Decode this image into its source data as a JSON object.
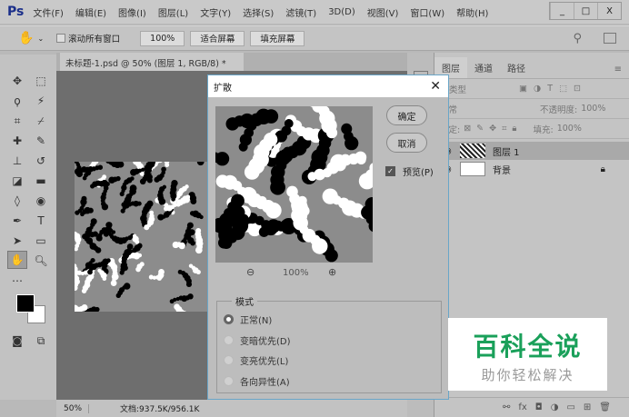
{
  "app": {
    "logo": "Ps",
    "menus": [
      "文件(F)",
      "编辑(E)",
      "图像(I)",
      "图层(L)",
      "文字(Y)",
      "选择(S)",
      "滤镜(T)",
      "3D(D)",
      "视图(V)",
      "窗口(W)",
      "帮助(H)"
    ],
    "window_buttons": [
      "_",
      "□",
      "X"
    ]
  },
  "options": {
    "scroll_all": "滚动所有窗口",
    "zoom_100": "100%",
    "fit_screen": "适合屏幕",
    "fill_screen": "填充屏幕"
  },
  "document": {
    "tab": "未标题-1.psd @ 50% (图层 1, RGB/8) *",
    "close": "×",
    "zoom": "50%",
    "doc_size": "文档:937.5K/956.1K"
  },
  "layers_panel": {
    "tabs": [
      "图层",
      "通道",
      "路径"
    ],
    "filter": "类型",
    "blend": "正常",
    "opacity_label": "不透明度:",
    "opacity": "100%",
    "lock_label": "锁定:",
    "fill_label": "填充:",
    "fill": "100%",
    "layers": [
      {
        "name": "图层 1"
      },
      {
        "name": "背景"
      }
    ]
  },
  "dialog": {
    "title": "扩散",
    "ok": "确定",
    "cancel": "取消",
    "preview": "预览(P)",
    "zoom": "100%",
    "mode_label": "模式",
    "modes": [
      "正常(N)",
      "变暗优先(D)",
      "变亮优先(L)",
      "各向异性(A)"
    ],
    "selected_mode": 0
  },
  "watermark": {
    "title": "百科全说",
    "subtitle": "助你轻松解决"
  }
}
